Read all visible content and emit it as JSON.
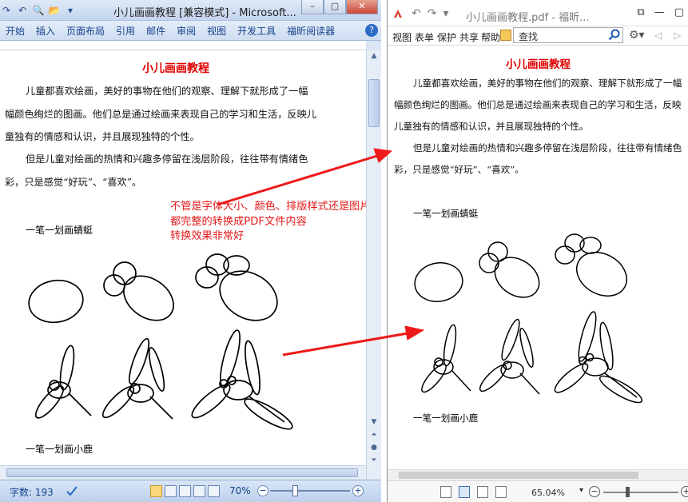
{
  "word": {
    "title": "小儿画画教程 [兼容模式] - Microsoft...",
    "menu": [
      "开始",
      "插入",
      "页面布局",
      "引用",
      "邮件",
      "审阅",
      "视图",
      "开发工具",
      "福昕阅读器"
    ],
    "heading": "小儿画画教程",
    "para1": "儿童都喜欢绘画，美好的事物在他们的观察、理解下就形成了一幅幅颜色绚烂的图画。他们总是通过绘画来表现自己的学习和生活，反映儿童独有的情感和认识，并且展现独特的个性。",
    "para2": "但是儿童对绘画的热情和兴趣多停留在浅层阶段，往往带有情绪色彩，只是感觉“好玩”、“喜欢”。",
    "caption_dragonfly": "一笔一划画蜻蜓",
    "caption_deer": "一笔一划画小鹿",
    "callout": [
      "不管是字体大小、颜色、排版样式还是图片",
      "都完整的转换成PDF文件内容",
      "转换效果非常好"
    ],
    "status": {
      "word_count": "字数: 193",
      "zoom": "70%"
    }
  },
  "foxit": {
    "title": "小儿画画教程.pdf - 福昕...",
    "tabs": [
      "视图",
      "表单",
      "保护",
      "共享",
      "帮助"
    ],
    "search_placeholder": "查找",
    "heading": "小儿画画教程",
    "para1": "儿童都喜欢绘画，美好的事物在他们的观察、理解下就形成了一幅幅颜色绚烂的图画。他们总是通过绘画来表现自己的学习和生活，反映儿童独有的情感和认识，并且展现独特的个性。",
    "para2": "但是儿童对绘画的热情和兴趣多停留在浅层阶段，往往带有情绪色彩，只是感觉“好玩”、“喜欢”。",
    "caption_dragonfly": "一笔一划画蜻蜓",
    "caption_deer": "一笔一划画小鹿",
    "status": {
      "zoom": "65.04%"
    }
  },
  "colors": {
    "heading_red": "#e00000",
    "callout_red": "#e21a1a",
    "arrow_red": "#ee1a1a"
  }
}
